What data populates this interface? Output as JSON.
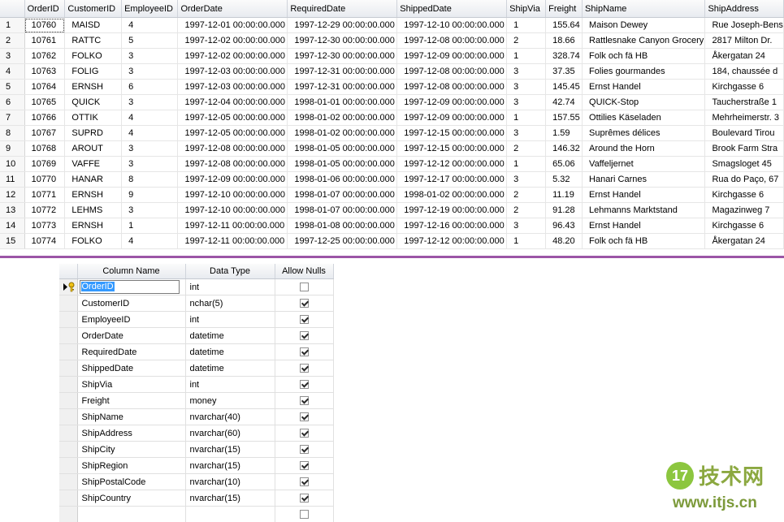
{
  "results": {
    "columns": [
      "",
      "OrderID",
      "CustomerID",
      "EmployeeID",
      "OrderDate",
      "RequiredDate",
      "ShippedDate",
      "ShipVia",
      "Freight",
      "ShipName",
      "ShipAddress"
    ],
    "rows": [
      [
        "1",
        "10760",
        "MAISD",
        "4",
        "1997-12-01 00:00:00.000",
        "1997-12-29 00:00:00.000",
        "1997-12-10 00:00:00.000",
        "1",
        "155.64",
        "Maison Dewey",
        "Rue Joseph-Bens"
      ],
      [
        "2",
        "10761",
        "RATTC",
        "5",
        "1997-12-02 00:00:00.000",
        "1997-12-30 00:00:00.000",
        "1997-12-08 00:00:00.000",
        "2",
        "18.66",
        "Rattlesnake Canyon Grocery",
        "2817 Milton Dr."
      ],
      [
        "3",
        "10762",
        "FOLKO",
        "3",
        "1997-12-02 00:00:00.000",
        "1997-12-30 00:00:00.000",
        "1997-12-09 00:00:00.000",
        "1",
        "328.74",
        "Folk och fä HB",
        "Åkergatan 24"
      ],
      [
        "4",
        "10763",
        "FOLIG",
        "3",
        "1997-12-03 00:00:00.000",
        "1997-12-31 00:00:00.000",
        "1997-12-08 00:00:00.000",
        "3",
        "37.35",
        "Folies gourmandes",
        "184, chaussée d"
      ],
      [
        "5",
        "10764",
        "ERNSH",
        "6",
        "1997-12-03 00:00:00.000",
        "1997-12-31 00:00:00.000",
        "1997-12-08 00:00:00.000",
        "3",
        "145.45",
        "Ernst Handel",
        "Kirchgasse 6"
      ],
      [
        "6",
        "10765",
        "QUICK",
        "3",
        "1997-12-04 00:00:00.000",
        "1998-01-01 00:00:00.000",
        "1997-12-09 00:00:00.000",
        "3",
        "42.74",
        "QUICK-Stop",
        "Taucherstraße 1"
      ],
      [
        "7",
        "10766",
        "OTTIK",
        "4",
        "1997-12-05 00:00:00.000",
        "1998-01-02 00:00:00.000",
        "1997-12-09 00:00:00.000",
        "1",
        "157.55",
        "Ottilies Käseladen",
        "Mehrheimerstr. 3"
      ],
      [
        "8",
        "10767",
        "SUPRD",
        "4",
        "1997-12-05 00:00:00.000",
        "1998-01-02 00:00:00.000",
        "1997-12-15 00:00:00.000",
        "3",
        "1.59",
        "Suprêmes délices",
        "Boulevard Tirou"
      ],
      [
        "9",
        "10768",
        "AROUT",
        "3",
        "1997-12-08 00:00:00.000",
        "1998-01-05 00:00:00.000",
        "1997-12-15 00:00:00.000",
        "2",
        "146.32",
        "Around the Horn",
        "Brook Farm Stra"
      ],
      [
        "10",
        "10769",
        "VAFFE",
        "3",
        "1997-12-08 00:00:00.000",
        "1998-01-05 00:00:00.000",
        "1997-12-12 00:00:00.000",
        "1",
        "65.06",
        "Vaffeljernet",
        "Smagsloget 45"
      ],
      [
        "11",
        "10770",
        "HANAR",
        "8",
        "1997-12-09 00:00:00.000",
        "1998-01-06 00:00:00.000",
        "1997-12-17 00:00:00.000",
        "3",
        "5.32",
        "Hanari Carnes",
        "Rua do Paço, 67"
      ],
      [
        "12",
        "10771",
        "ERNSH",
        "9",
        "1997-12-10 00:00:00.000",
        "1998-01-07 00:00:00.000",
        "1998-01-02 00:00:00.000",
        "2",
        "11.19",
        "Ernst Handel",
        "Kirchgasse 6"
      ],
      [
        "13",
        "10772",
        "LEHMS",
        "3",
        "1997-12-10 00:00:00.000",
        "1998-01-07 00:00:00.000",
        "1997-12-19 00:00:00.000",
        "2",
        "91.28",
        "Lehmanns Marktstand",
        "Magazinweg 7"
      ],
      [
        "14",
        "10773",
        "ERNSH",
        "1",
        "1997-12-11 00:00:00.000",
        "1998-01-08 00:00:00.000",
        "1997-12-16 00:00:00.000",
        "3",
        "96.43",
        "Ernst Handel",
        "Kirchgasse 6"
      ],
      [
        "15",
        "10774",
        "FOLKO",
        "4",
        "1997-12-11 00:00:00.000",
        "1997-12-25 00:00:00.000",
        "1997-12-12 00:00:00.000",
        "1",
        "48.20",
        "Folk och fä HB",
        "Åkergatan 24"
      ]
    ]
  },
  "designer": {
    "headers": [
      "",
      "Column Name",
      "Data Type",
      "Allow Nulls"
    ],
    "columns": [
      {
        "name": "OrderID",
        "type": "int",
        "allow_nulls": false,
        "primary_key": true
      },
      {
        "name": "CustomerID",
        "type": "nchar(5)",
        "allow_nulls": true
      },
      {
        "name": "EmployeeID",
        "type": "int",
        "allow_nulls": true
      },
      {
        "name": "OrderDate",
        "type": "datetime",
        "allow_nulls": true
      },
      {
        "name": "RequiredDate",
        "type": "datetime",
        "allow_nulls": true
      },
      {
        "name": "ShippedDate",
        "type": "datetime",
        "allow_nulls": true
      },
      {
        "name": "ShipVia",
        "type": "int",
        "allow_nulls": true
      },
      {
        "name": "Freight",
        "type": "money",
        "allow_nulls": true
      },
      {
        "name": "ShipName",
        "type": "nvarchar(40)",
        "allow_nulls": true
      },
      {
        "name": "ShipAddress",
        "type": "nvarchar(60)",
        "allow_nulls": true
      },
      {
        "name": "ShipCity",
        "type": "nvarchar(15)",
        "allow_nulls": true
      },
      {
        "name": "ShipRegion",
        "type": "nvarchar(15)",
        "allow_nulls": true
      },
      {
        "name": "ShipPostalCode",
        "type": "nvarchar(10)",
        "allow_nulls": true
      },
      {
        "name": "ShipCountry",
        "type": "nvarchar(15)",
        "allow_nulls": true
      },
      {
        "name": "",
        "type": "",
        "allow_nulls": false
      }
    ]
  },
  "watermark": {
    "logo_text": "17",
    "title": "技术网",
    "url": "www.itjs.cn"
  },
  "colors": {
    "splitter": "#9b55a6",
    "selection": "#3399ff",
    "watermark": "#8cc63f"
  }
}
